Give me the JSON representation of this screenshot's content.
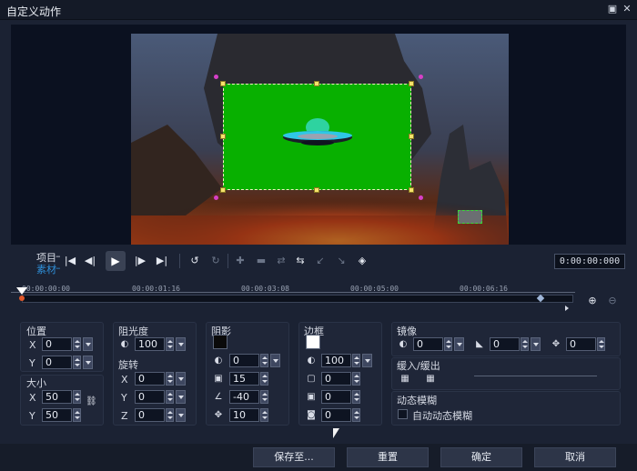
{
  "window": {
    "title": "自定义动作",
    "maximize_icon": "maximize-icon",
    "close_icon": "close-icon"
  },
  "playback": {
    "project_label": "项目",
    "clip_label": "素材",
    "timecode": "0:00:00:000"
  },
  "timeline": {
    "ticks": [
      "00:00:00:00",
      "00:00:01:16",
      "00:00:03:08",
      "00:00:05:00",
      "00:00:06:16"
    ],
    "playhead_fraction": 0.0,
    "keyframe_fraction": 0.94
  },
  "position": {
    "title": "位置",
    "x_label": "X",
    "x": "0",
    "y_label": "Y",
    "y": "0"
  },
  "size": {
    "title": "大小",
    "x_label": "X",
    "x": "50",
    "y_label": "Y",
    "y": "50"
  },
  "opacity": {
    "title": "阻光度",
    "value": "100"
  },
  "rotation": {
    "title": "旋转",
    "x_label": "X",
    "x": "0",
    "y_label": "Y",
    "y": "0",
    "z_label": "Z",
    "z": "0"
  },
  "shadow": {
    "title": "阴影",
    "color": "#0a0a0a",
    "v1": "0",
    "v2": "15",
    "v3": "-40",
    "v4": "10"
  },
  "border": {
    "title": "边框",
    "color": "#ffffff",
    "v1": "100",
    "v2": "0",
    "v3": "0",
    "v4": "0"
  },
  "mirror": {
    "title": "镜像",
    "v1": "0",
    "v2": "0",
    "v3": "0"
  },
  "ease": {
    "title": "缓入/缓出"
  },
  "motion_blur": {
    "title": "动态模糊",
    "checkbox_label": "自动动态模糊",
    "checked": false
  },
  "buttons": {
    "save_as": "保存至...",
    "reset": "重置",
    "ok": "确定",
    "cancel": "取消"
  },
  "colors": {
    "accent": "#2f8fd8",
    "green_screen": "#08b000"
  }
}
